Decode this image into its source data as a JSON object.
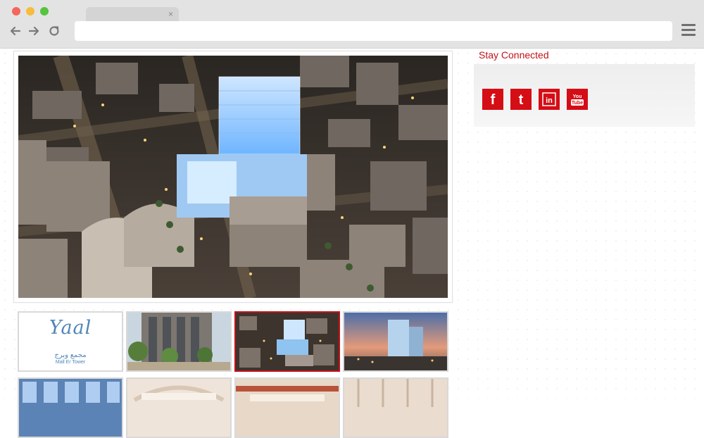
{
  "browser": {
    "tab_close": "×",
    "icons": {
      "back": "back-arrow-icon",
      "forward": "forward-arrow-icon",
      "reload": "reload-icon",
      "menu": "hamburger-menu-icon"
    }
  },
  "gallery": {
    "main_image": "aerial night render of Mall Er Tower",
    "thumbnails": [
      {
        "kind": "logo",
        "script": "Yaal",
        "arabic": "مجمع وبرج",
        "english": "Mall Er Tower"
      },
      {
        "kind": "photo",
        "subject": "building facade with palms"
      },
      {
        "kind": "photo",
        "subject": "aerial night view",
        "active": true
      },
      {
        "kind": "photo",
        "subject": "tower at dusk"
      },
      {
        "kind": "photo",
        "subject": "interior atrium"
      },
      {
        "kind": "photo",
        "subject": "interior hall"
      },
      {
        "kind": "photo",
        "subject": "interior mall"
      },
      {
        "kind": "photo",
        "subject": "interior corridor"
      }
    ]
  },
  "sidebar": {
    "stay_connected": "Stay Connected",
    "social": [
      {
        "name": "facebook-icon",
        "glyph": "f"
      },
      {
        "name": "twitter-icon",
        "glyph": "t"
      },
      {
        "name": "linkedin-icon",
        "glyph": "in"
      },
      {
        "name": "youtube-icon",
        "glyph": "You Tube"
      }
    ]
  },
  "colors": {
    "accent": "#c4121a",
    "social_bg": "#d50d15",
    "logo_blue": "#4f86b8"
  }
}
